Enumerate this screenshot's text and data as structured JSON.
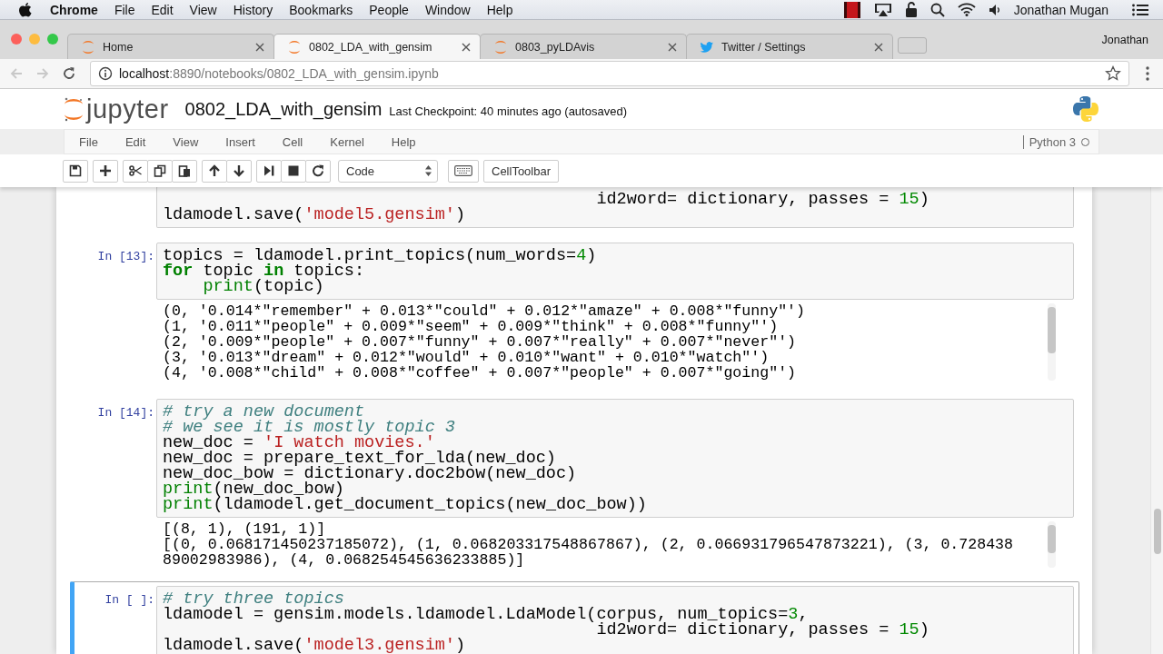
{
  "menubar": {
    "app": "Chrome",
    "items": [
      "File",
      "Edit",
      "View",
      "History",
      "Bookmarks",
      "People",
      "Window",
      "Help"
    ],
    "user": "Jonathan Mugan"
  },
  "browser": {
    "tabs": [
      {
        "title": "Home",
        "kind": "jupyter",
        "selected": false
      },
      {
        "title": "0802_LDA_with_gensim",
        "kind": "jupyter",
        "selected": true
      },
      {
        "title": "0803_pyLDAvis",
        "kind": "jupyter",
        "selected": false
      },
      {
        "title": "Twitter / Settings",
        "kind": "bird",
        "selected": false
      }
    ],
    "profile": "Jonathan",
    "url": {
      "host": "localhost",
      "path": ":8890/notebooks/0802_LDA_with_gensim.ipynb"
    }
  },
  "notebook": {
    "logo_text": "jupyter",
    "name": "0802_LDA_with_gensim",
    "checkpoint": "Last Checkpoint: 40 minutes ago (autosaved)",
    "menu": [
      "File",
      "Edit",
      "View",
      "Insert",
      "Cell",
      "Kernel",
      "Help"
    ],
    "kernel": "Python 3",
    "kernel_busy": false,
    "cell_type": "Code",
    "celltoolbar": "CellToolbar"
  },
  "cells": [
    {
      "selected": false,
      "input": [
        [
          {
            "kind": "code",
            "text": "                                           id2word= dictionary, passes = "
          },
          {
            "kind": "num",
            "text": "15"
          },
          {
            "kind": "code",
            "text": ")"
          }
        ],
        [
          {
            "kind": "code",
            "text": "ldamodel.save("
          },
          {
            "kind": "str",
            "text": "'model5.gensim'"
          },
          {
            "kind": "code",
            "text": ")"
          }
        ]
      ]
    },
    {
      "prompt": "In [13]:",
      "selected": false,
      "input": [
        [
          {
            "kind": "code",
            "text": "topics = ldamodel.print_topics(num_words="
          },
          {
            "kind": "num",
            "text": "4"
          },
          {
            "kind": "code",
            "text": ")"
          }
        ],
        [
          {
            "kind": "kw",
            "text": "for"
          },
          {
            "kind": "code",
            "text": " topic "
          },
          {
            "kind": "kw",
            "text": "in"
          },
          {
            "kind": "code",
            "text": " topics:"
          }
        ],
        [
          {
            "kind": "builtin",
            "text": "    print"
          },
          {
            "kind": "code",
            "text": "(topic)"
          }
        ]
      ],
      "output": [
        "(0, '0.014*\"remember\" + 0.013*\"could\" + 0.012*\"amaze\" + 0.008*\"funny\"')",
        "(1, '0.011*\"people\" + 0.009*\"seem\" + 0.009*\"think\" + 0.008*\"funny\"')",
        "(2, '0.009*\"people\" + 0.007*\"funny\" + 0.007*\"really\" + 0.007*\"never\"')",
        "(3, '0.013*\"dream\" + 0.012*\"would\" + 0.010*\"want\" + 0.010*\"watch\"')",
        "(4, '0.008*\"child\" + 0.008*\"coffee\" + 0.007*\"people\" + 0.007*\"going\"')"
      ]
    },
    {
      "prompt": "In [14]:",
      "selected": false,
      "input": [
        [
          {
            "kind": "comment",
            "text": "# try a new document"
          }
        ],
        [
          {
            "kind": "comment",
            "text": "# we see it is mostly topic 3"
          }
        ],
        [
          {
            "kind": "code",
            "text": "new_doc = "
          },
          {
            "kind": "str",
            "text": "'I watch movies.'"
          }
        ],
        [
          {
            "kind": "code",
            "text": "new_doc = prepare_text_for_lda(new_doc)"
          }
        ],
        [
          {
            "kind": "code",
            "text": "new_doc_bow = dictionary.doc2bow(new_doc)"
          }
        ],
        [
          {
            "kind": "builtin",
            "text": "print"
          },
          {
            "kind": "code",
            "text": "(new_doc_bow)"
          }
        ],
        [
          {
            "kind": "builtin",
            "text": "print"
          },
          {
            "kind": "code",
            "text": "(ldamodel.get_document_topics(new_doc_bow))"
          }
        ]
      ],
      "output": [
        "[(8, 1), (191, 1)]",
        "[(0, 0.068171450237185072), (1, 0.068203317548867867), (2, 0.066931796547873221), (3, 0.728438",
        "89002983986), (4, 0.068254545636233885)]"
      ]
    },
    {
      "prompt": "In [ ]:",
      "selected": true,
      "input": [
        [
          {
            "kind": "comment",
            "text": "# try three topics"
          }
        ],
        [
          {
            "kind": "code",
            "text": "ldamodel = gensim.models.ldamodel.LdaModel(corpus, num_topics="
          },
          {
            "kind": "num",
            "text": "3"
          },
          {
            "kind": "code",
            "text": ","
          }
        ],
        [
          {
            "kind": "code",
            "text": "                                           id2word= dictionary, passes = "
          },
          {
            "kind": "num",
            "text": "15"
          },
          {
            "kind": "code",
            "text": ")"
          }
        ],
        [
          {
            "kind": "code",
            "text": "ldamodel.save("
          },
          {
            "kind": "str",
            "text": "'model3.gensim'"
          },
          {
            "kind": "code",
            "text": ")"
          }
        ]
      ]
    }
  ]
}
